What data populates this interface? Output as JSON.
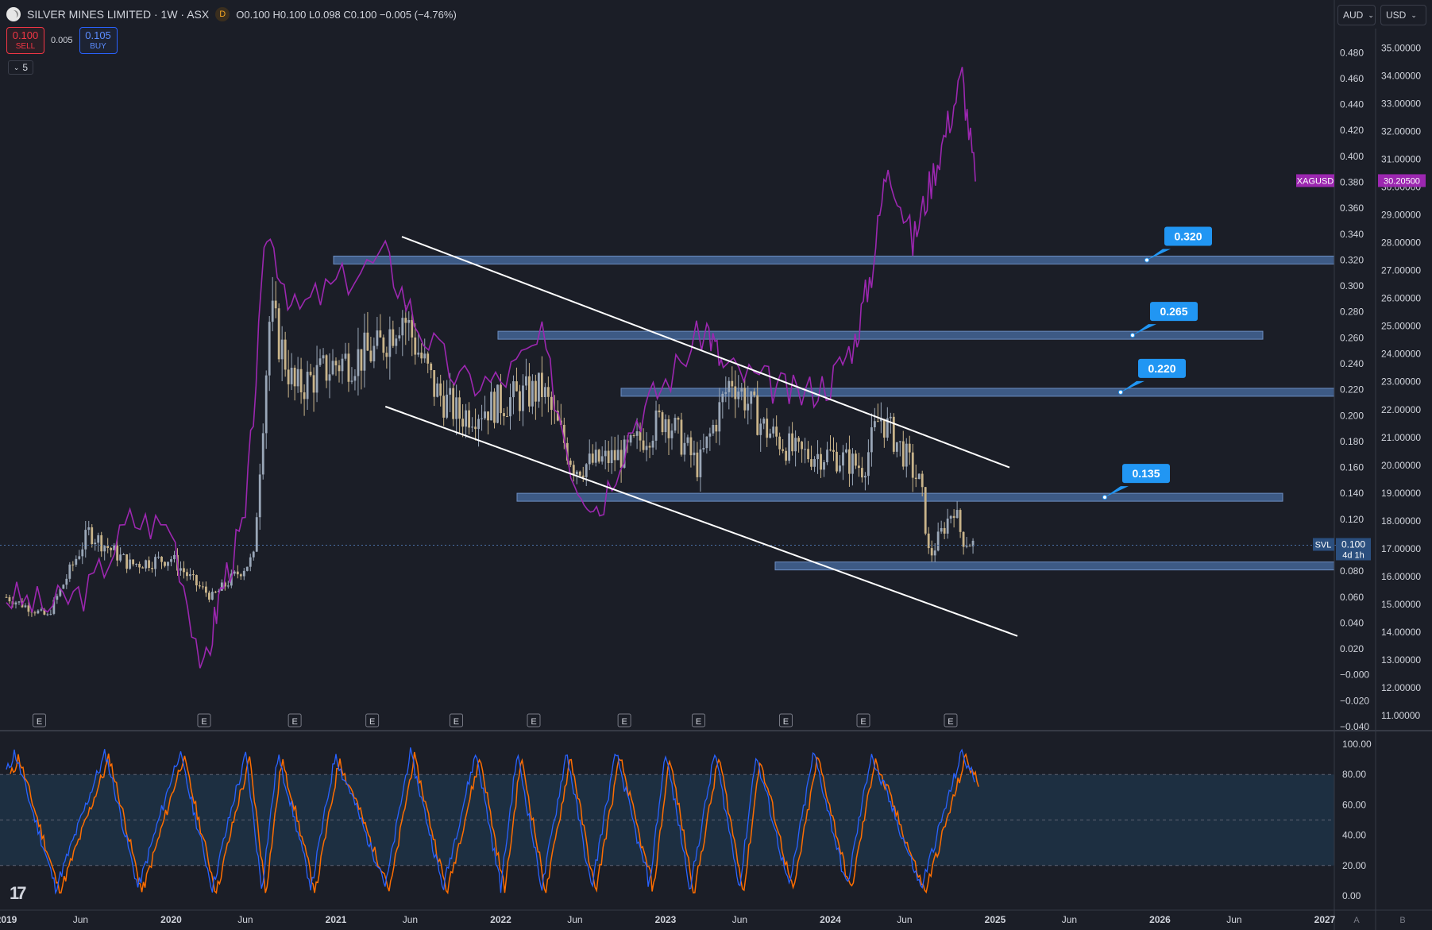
{
  "header": {
    "symbol_title": "SILVER MINES LIMITED · 1W · ASX",
    "interval_badge": "D",
    "ohlc": "O0.100  H0.100  L0.098  C0.100  −0.005 (−4.76%)"
  },
  "trade": {
    "sell_price": "0.100",
    "sell_label": "SELL",
    "spread": "0.005",
    "buy_price": "0.105",
    "buy_label": "BUY"
  },
  "indicators_collapse": {
    "count": "5"
  },
  "currency_left": "AUD",
  "currency_right": "USD",
  "price_axis_left": [
    "0.480",
    "0.460",
    "0.440",
    "0.420",
    "0.400",
    "0.380",
    "0.360",
    "0.340",
    "0.320",
    "0.300",
    "0.280",
    "0.260",
    "0.240",
    "0.220",
    "0.200",
    "0.180",
    "0.160",
    "0.140",
    "0.120",
    "0.100",
    "0.080",
    "0.060",
    "0.040",
    "0.020",
    "−0.000",
    "−0.020",
    "−0.040"
  ],
  "price_axis_right": [
    "35.00000",
    "34.00000",
    "33.00000",
    "32.00000",
    "31.00000",
    "30.00000",
    "29.00000",
    "28.00000",
    "27.00000",
    "26.00000",
    "25.00000",
    "24.00000",
    "23.00000",
    "22.00000",
    "21.00000",
    "20.00000",
    "19.00000",
    "18.00000",
    "17.00000",
    "16.00000",
    "15.00000",
    "14.00000",
    "13.00000",
    "12.00000",
    "11.00000"
  ],
  "overlay_symbol": {
    "name": "XAGUSD",
    "price": "30.20500",
    "color": "#9c27b0"
  },
  "last_price": {
    "symbol": "SVL",
    "price": "0.100",
    "countdown": "4d 1h"
  },
  "levels": [
    {
      "label": "0.320",
      "value": 0.32
    },
    {
      "label": "0.265",
      "value": 0.262
    },
    {
      "label": "0.220",
      "value": 0.218
    },
    {
      "label": "0.135",
      "value": 0.137
    },
    {
      "label": "",
      "value": 0.084
    }
  ],
  "time_axis": [
    "2019",
    "Jun",
    "2020",
    "Jun",
    "2021",
    "Jun",
    "2022",
    "Jun",
    "2023",
    "Jun",
    "2024",
    "Jun",
    "2025",
    "Jun",
    "2026",
    "Jun",
    "2027"
  ],
  "earnings_marker": "E",
  "stoch_axis": [
    "100.00",
    "80.00",
    "60.00",
    "40.00",
    "20.00",
    "0.00"
  ],
  "footer_buttons": [
    "A",
    "B"
  ],
  "colors": {
    "background": "#1b1e27",
    "level_fill": "#4a6fa5",
    "callout": "#2196f3",
    "overlay_line": "#9c27b0",
    "stoch_k": "#2962ff",
    "stoch_d": "#ff6d00",
    "stoch_band": "#1e3348"
  },
  "chart_data": {
    "type": "line",
    "title": "SILVER MINES LIMITED · 1W · ASX",
    "xlabel": "",
    "ylabel": "",
    "x_range": [
      "2019",
      "2027"
    ],
    "ylim": [
      -0.04,
      0.49
    ],
    "secondary_ylim": [
      10.6,
      35.3
    ],
    "series": [
      {
        "name": "SVL",
        "x": [
          2019.0,
          2019.25,
          2019.5,
          2019.75,
          2020.0,
          2020.15,
          2020.25,
          2020.5,
          2020.6,
          2020.75,
          2021.0,
          2021.25,
          2021.4,
          2021.6,
          2021.75,
          2022.0,
          2022.25,
          2022.45,
          2022.75,
          2023.0,
          2023.2,
          2023.4,
          2023.6,
          2023.8,
          2024.0,
          2024.2,
          2024.3,
          2024.45,
          2024.55,
          2024.6,
          2024.75,
          2024.8,
          2024.88
        ],
        "values": [
          0.06,
          0.045,
          0.11,
          0.085,
          0.09,
          0.07,
          0.06,
          0.09,
          0.28,
          0.22,
          0.24,
          0.25,
          0.28,
          0.22,
          0.2,
          0.21,
          0.22,
          0.16,
          0.17,
          0.2,
          0.16,
          0.23,
          0.19,
          0.17,
          0.17,
          0.16,
          0.2,
          0.17,
          0.145,
          0.09,
          0.13,
          0.105,
          0.1
        ]
      },
      {
        "name": "XAGUSD",
        "axis": "right",
        "x": [
          2019.0,
          2019.25,
          2019.5,
          2019.75,
          2020.0,
          2020.2,
          2020.3,
          2020.45,
          2020.58,
          2020.75,
          2021.0,
          2021.3,
          2021.5,
          2021.75,
          2022.0,
          2022.25,
          2022.45,
          2022.6,
          2022.8,
          2023.0,
          2023.25,
          2023.35,
          2023.6,
          2023.8,
          2024.0,
          2024.15,
          2024.25,
          2024.35,
          2024.5,
          2024.6,
          2024.7,
          2024.8,
          2024.88
        ],
        "values": [
          15.3,
          14.9,
          15.5,
          18.0,
          17.8,
          12.5,
          15.5,
          18.0,
          28.5,
          25.5,
          26.5,
          27.5,
          25.0,
          23.0,
          23.0,
          24.5,
          19.5,
          18.5,
          21.5,
          23.0,
          25.0,
          23.5,
          23.0,
          22.5,
          23.0,
          24.5,
          27.0,
          31.0,
          28.0,
          30.0,
          32.0,
          34.0,
          30.2
        ]
      }
    ],
    "horizontal_levels": [
      0.32,
      0.262,
      0.218,
      0.137,
      0.084
    ],
    "channel_upper": [
      [
        2021.4,
        0.338
      ],
      [
        2025.0,
        0.16
      ]
    ],
    "channel_lower": [
      [
        2021.3,
        0.207
      ],
      [
        2025.0,
        0.03
      ]
    ],
    "stochastic": {
      "ylim": [
        0,
        100
      ],
      "bands": [
        20,
        50,
        80
      ],
      "k_last": 64,
      "d_last": 70
    }
  }
}
